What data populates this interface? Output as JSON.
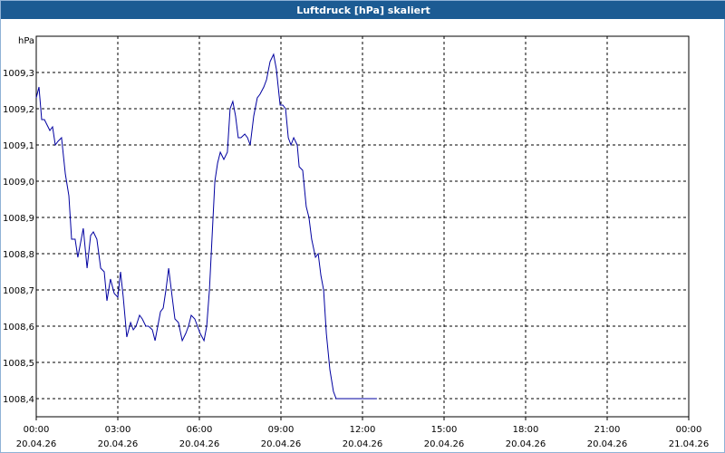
{
  "window": {
    "title": "Luftdruck [hPa] skaliert"
  },
  "chart_data": {
    "type": "line",
    "title": "Luftdruck [hPa] skaliert",
    "ylabel": "hPa",
    "xlabel": "",
    "x_unit": "hours since 20.04.26 00:00",
    "xlim": [
      0,
      24
    ],
    "ylim": [
      1008.35,
      1009.4
    ],
    "grid": true,
    "y_ticks": [
      {
        "value": 1009.3,
        "label": "1009,3"
      },
      {
        "value": 1009.2,
        "label": "1009,2"
      },
      {
        "value": 1009.1,
        "label": "1009,1"
      },
      {
        "value": 1009.0,
        "label": "1009,0"
      },
      {
        "value": 1008.9,
        "label": "1008,9"
      },
      {
        "value": 1008.8,
        "label": "1008,8"
      },
      {
        "value": 1008.7,
        "label": "1008,7"
      },
      {
        "value": 1008.6,
        "label": "1008,6"
      },
      {
        "value": 1008.5,
        "label": "1008,5"
      },
      {
        "value": 1008.4,
        "label": "1008,4"
      }
    ],
    "x_ticks": [
      {
        "value": 0,
        "time": "00:00",
        "date": "20.04.26"
      },
      {
        "value": 3,
        "time": "03:00",
        "date": "20.04.26"
      },
      {
        "value": 6,
        "time": "06:00",
        "date": "20.04.26"
      },
      {
        "value": 9,
        "time": "09:00",
        "date": "20.04.26"
      },
      {
        "value": 12,
        "time": "12:00",
        "date": "20.04.26"
      },
      {
        "value": 15,
        "time": "15:00",
        "date": "20.04.26"
      },
      {
        "value": 18,
        "time": "18:00",
        "date": "20.04.26"
      },
      {
        "value": 21,
        "time": "21:00",
        "date": "20.04.26"
      },
      {
        "value": 24,
        "time": "00:00",
        "date": "21.04.26"
      }
    ],
    "series": [
      {
        "name": "Luftdruck",
        "color": "#0000a0",
        "x": [
          0.0,
          0.1,
          0.2,
          0.3,
          0.5,
          0.6,
          0.7,
          0.8,
          0.93,
          1.07,
          1.2,
          1.3,
          1.43,
          1.53,
          1.63,
          1.73,
          1.87,
          2.0,
          2.1,
          2.23,
          2.37,
          2.5,
          2.6,
          2.73,
          2.87,
          3.0,
          3.1,
          3.2,
          3.33,
          3.47,
          3.57,
          3.67,
          3.8,
          3.9,
          4.03,
          4.13,
          4.27,
          4.37,
          4.47,
          4.57,
          4.67,
          4.77,
          4.87,
          5.0,
          5.1,
          5.23,
          5.37,
          5.5,
          5.6,
          5.7,
          5.83,
          5.93,
          6.03,
          6.17,
          6.27,
          6.37,
          6.47,
          6.57,
          6.67,
          6.77,
          6.9,
          7.03,
          7.13,
          7.23,
          7.33,
          7.43,
          7.53,
          7.67,
          7.77,
          7.87,
          8.0,
          8.13,
          8.23,
          8.37,
          8.47,
          8.6,
          8.73,
          8.83,
          8.97,
          9.07,
          9.17,
          9.27,
          9.37,
          9.47,
          9.6,
          9.67,
          9.8,
          9.93,
          10.03,
          10.13,
          10.27,
          10.37,
          10.47,
          10.57,
          10.67,
          10.8,
          10.93,
          11.03,
          11.17,
          11.27,
          11.37,
          11.5,
          11.63,
          11.77,
          11.87,
          12.0,
          12.13,
          12.27,
          12.4,
          12.53
        ],
        "y": [
          1009.23,
          1009.26,
          1009.17,
          1009.17,
          1009.14,
          1009.15,
          1009.1,
          1009.11,
          1009.12,
          1009.02,
          1008.96,
          1008.84,
          1008.84,
          1008.79,
          1008.83,
          1008.87,
          1008.76,
          1008.85,
          1008.86,
          1008.84,
          1008.76,
          1008.75,
          1008.67,
          1008.73,
          1008.69,
          1008.68,
          1008.75,
          1008.68,
          1008.57,
          1008.61,
          1008.59,
          1008.6,
          1008.63,
          1008.62,
          1008.6,
          1008.6,
          1008.59,
          1008.56,
          1008.6,
          1008.64,
          1008.65,
          1008.7,
          1008.76,
          1008.68,
          1008.62,
          1008.61,
          1008.56,
          1008.58,
          1008.6,
          1008.63,
          1008.62,
          1008.6,
          1008.58,
          1008.56,
          1008.6,
          1008.7,
          1008.85,
          1009.0,
          1009.05,
          1009.08,
          1009.06,
          1009.08,
          1009.2,
          1009.22,
          1009.18,
          1009.12,
          1009.12,
          1009.13,
          1009.12,
          1009.1,
          1009.18,
          1009.23,
          1009.24,
          1009.26,
          1009.28,
          1009.33,
          1009.35,
          1009.31,
          1009.21,
          1009.21,
          1009.2,
          1009.12,
          1009.1,
          1009.12,
          1009.1,
          1009.04,
          1009.03,
          1008.93,
          1008.9,
          1008.84,
          1008.79,
          1008.8,
          1008.74,
          1008.7,
          1008.58,
          1008.48,
          1008.42,
          1008.4,
          1008.4,
          1008.4,
          1008.4,
          1008.4,
          1008.4,
          1008.4,
          1008.4,
          1008.4,
          1008.4,
          1008.4,
          1008.4,
          1008.4
        ]
      }
    ]
  }
}
